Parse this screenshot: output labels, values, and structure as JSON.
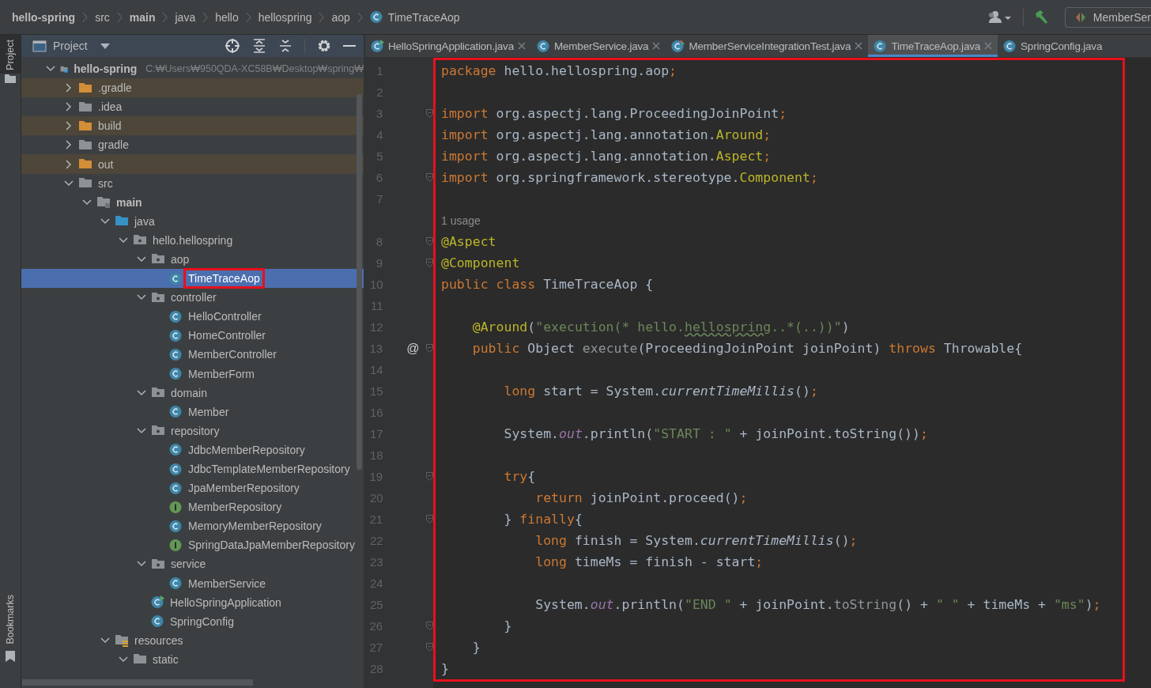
{
  "breadcrumb": [
    {
      "label": "hello-spring",
      "kind": "module"
    },
    {
      "label": "src",
      "kind": "folder"
    },
    {
      "label": "main",
      "kind": "source-set"
    },
    {
      "label": "java",
      "kind": "folder"
    },
    {
      "label": "hello",
      "kind": "folder"
    },
    {
      "label": "hellospring",
      "kind": "folder"
    },
    {
      "label": "aop",
      "kind": "folder"
    },
    {
      "label": "TimeTraceAop",
      "kind": "class"
    }
  ],
  "toolbar": {
    "run_config": "MemberSer"
  },
  "tool_stripe": {
    "top": [
      {
        "label": "Project",
        "selected": true
      }
    ],
    "bottom": [
      {
        "label": "Bookmarks",
        "selected": false
      }
    ]
  },
  "project_panel": {
    "title": "Project",
    "tree": [
      {
        "label": "hello-spring",
        "kind": "module",
        "path": "C:₩Users₩950QDA-XC58B₩Desktop₩spring₩",
        "expanded": true,
        "selected": false,
        "children": [
          {
            "label": ".gradle",
            "kind": "excluded",
            "expanded": false,
            "selected": false
          },
          {
            "label": ".idea",
            "kind": "folder",
            "expanded": false,
            "selected": false
          },
          {
            "label": "build",
            "kind": "excluded",
            "expanded": false,
            "selected": false
          },
          {
            "label": "gradle",
            "kind": "folder",
            "expanded": false,
            "selected": false
          },
          {
            "label": "out",
            "kind": "excluded",
            "expanded": false,
            "selected": false
          },
          {
            "label": "src",
            "kind": "folder",
            "expanded": true,
            "selected": false,
            "children": [
              {
                "label": "main",
                "kind": "source-set",
                "expanded": true,
                "selected": false,
                "children": [
                  {
                    "label": "java",
                    "kind": "source-root",
                    "expanded": true,
                    "selected": false,
                    "children": [
                      {
                        "label": "hello.hellospring",
                        "kind": "package",
                        "expanded": true,
                        "selected": false,
                        "children": [
                          {
                            "label": "aop",
                            "kind": "package",
                            "expanded": true,
                            "selected": false,
                            "children": [
                              {
                                "label": "TimeTraceAop",
                                "kind": "class",
                                "selected": true,
                                "annotated": true
                              }
                            ]
                          },
                          {
                            "label": "controller",
                            "kind": "package",
                            "expanded": true,
                            "selected": false,
                            "children": [
                              {
                                "label": "HelloController",
                                "kind": "class",
                                "selected": false
                              },
                              {
                                "label": "HomeController",
                                "kind": "class",
                                "selected": false
                              },
                              {
                                "label": "MemberController",
                                "kind": "class",
                                "selected": false
                              },
                              {
                                "label": "MemberForm",
                                "kind": "class",
                                "selected": false
                              }
                            ]
                          },
                          {
                            "label": "domain",
                            "kind": "package",
                            "expanded": true,
                            "selected": false,
                            "children": [
                              {
                                "label": "Member",
                                "kind": "class",
                                "selected": false
                              }
                            ]
                          },
                          {
                            "label": "repository",
                            "kind": "package",
                            "expanded": true,
                            "selected": false,
                            "children": [
                              {
                                "label": "JdbcMemberRepository",
                                "kind": "class",
                                "selected": false
                              },
                              {
                                "label": "JdbcTemplateMemberRepository",
                                "kind": "class",
                                "selected": false
                              },
                              {
                                "label": "JpaMemberRepository",
                                "kind": "class",
                                "selected": false
                              },
                              {
                                "label": "MemberRepository",
                                "kind": "interface",
                                "selected": false
                              },
                              {
                                "label": "MemoryMemberRepository",
                                "kind": "class",
                                "selected": false
                              },
                              {
                                "label": "SpringDataJpaMemberRepository",
                                "kind": "interface",
                                "selected": false
                              }
                            ]
                          },
                          {
                            "label": "service",
                            "kind": "package",
                            "expanded": true,
                            "selected": false,
                            "children": [
                              {
                                "label": "MemberService",
                                "kind": "class",
                                "selected": false
                              }
                            ]
                          },
                          {
                            "label": "HelloSpringApplication",
                            "kind": "runnable-class",
                            "selected": false
                          },
                          {
                            "label": "SpringConfig",
                            "kind": "class",
                            "selected": false
                          }
                        ]
                      }
                    ]
                  },
                  {
                    "label": "resources",
                    "kind": "resources",
                    "expanded": true,
                    "selected": false,
                    "children": [
                      {
                        "label": "static",
                        "kind": "folder",
                        "expanded": true,
                        "selected": false
                      }
                    ]
                  }
                ]
              }
            ]
          }
        ]
      }
    ]
  },
  "tabs": [
    {
      "label": "HelloSpringApplication.java",
      "kind": "runnable-class",
      "selected": false,
      "closable": true
    },
    {
      "label": "MemberService.java",
      "kind": "class",
      "selected": false,
      "closable": true
    },
    {
      "label": "MemberServiceIntegrationTest.java",
      "kind": "test-class",
      "selected": false,
      "closable": true
    },
    {
      "label": "TimeTraceAop.java",
      "kind": "class",
      "selected": true,
      "closable": true
    },
    {
      "label": "SpringConfig.java",
      "kind": "class",
      "selected": false,
      "closable": false
    }
  ],
  "editor": {
    "annotated": true,
    "lines": [
      {
        "kind": "code",
        "number": "1",
        "fold": false,
        "tokens": [
          {
            "kind": "keyword",
            "text": "package"
          },
          {
            "kind": "plain",
            "text": " hello.hellospring.aop"
          },
          {
            "kind": "keyword",
            "text": ";"
          }
        ]
      },
      {
        "kind": "code",
        "number": "2",
        "fold": false
      },
      {
        "kind": "code",
        "number": "3",
        "fold": true,
        "tokens": [
          {
            "kind": "keyword",
            "text": "import"
          },
          {
            "kind": "plain",
            "text": " org.aspectj.lang.ProceedingJoinPoint"
          },
          {
            "kind": "keyword",
            "text": ";"
          }
        ]
      },
      {
        "kind": "code",
        "number": "4",
        "fold": false,
        "tokens": [
          {
            "kind": "keyword",
            "text": "import"
          },
          {
            "kind": "plain",
            "text": " org.aspectj.lang.annotation."
          },
          {
            "kind": "annotation",
            "text": "Around"
          },
          {
            "kind": "keyword",
            "text": ";"
          }
        ]
      },
      {
        "kind": "code",
        "number": "5",
        "fold": false,
        "tokens": [
          {
            "kind": "keyword",
            "text": "import"
          },
          {
            "kind": "plain",
            "text": " org.aspectj.lang.annotation."
          },
          {
            "kind": "annotation",
            "text": "Aspect"
          },
          {
            "kind": "keyword",
            "text": ";"
          }
        ]
      },
      {
        "kind": "code",
        "number": "6",
        "fold": true,
        "tokens": [
          {
            "kind": "keyword",
            "text": "import"
          },
          {
            "kind": "plain",
            "text": " org.springframework.stereotype."
          },
          {
            "kind": "annotation",
            "text": "Component"
          },
          {
            "kind": "keyword",
            "text": ";"
          }
        ]
      },
      {
        "kind": "code",
        "number": "7",
        "fold": false
      },
      {
        "kind": "hint",
        "text": "1 usage"
      },
      {
        "kind": "code",
        "number": "8",
        "fold": true,
        "tokens": [
          {
            "kind": "annotation",
            "text": "@Aspect"
          }
        ]
      },
      {
        "kind": "code",
        "number": "9",
        "fold": true,
        "tokens": [
          {
            "kind": "annotation",
            "text": "@Component"
          }
        ]
      },
      {
        "kind": "code",
        "number": "10",
        "fold": false,
        "tokens": [
          {
            "kind": "keyword",
            "text": "public class "
          },
          {
            "kind": "plain",
            "text": "TimeTraceAop {"
          }
        ]
      },
      {
        "kind": "code",
        "number": "11",
        "fold": false
      },
      {
        "kind": "code",
        "number": "12",
        "fold": false,
        "tokens": [
          {
            "kind": "annotation",
            "text": "    @Around"
          },
          {
            "kind": "plain",
            "text": "("
          },
          {
            "kind": "string",
            "text": "\"execution(* hello."
          },
          {
            "kind": "string-warning",
            "text": "hellospring"
          },
          {
            "kind": "string",
            "text": "..*(..))\""
          },
          {
            "kind": "plain",
            "text": ")"
          }
        ]
      },
      {
        "kind": "code",
        "number": "13",
        "fold": true,
        "gutter_mark": "@",
        "tokens": [
          {
            "kind": "keyword",
            "text": "    public "
          },
          {
            "kind": "plain",
            "text": "Object "
          },
          {
            "kind": "unused",
            "text": "execute"
          },
          {
            "kind": "plain",
            "text": "(ProceedingJoinPoint joinPoint) "
          },
          {
            "kind": "keyword",
            "text": "throws "
          },
          {
            "kind": "plain",
            "text": "Throwable{"
          }
        ]
      },
      {
        "kind": "code",
        "number": "14",
        "fold": false
      },
      {
        "kind": "code",
        "number": "15",
        "fold": false,
        "tokens": [
          {
            "kind": "keyword",
            "text": "        long "
          },
          {
            "kind": "plain",
            "text": "start = System."
          },
          {
            "kind": "static-method",
            "text": "currentTimeMillis"
          },
          {
            "kind": "plain",
            "text": "()"
          },
          {
            "kind": "keyword",
            "text": ";"
          }
        ]
      },
      {
        "kind": "code",
        "number": "16",
        "fold": false
      },
      {
        "kind": "code",
        "number": "17",
        "fold": false,
        "tokens": [
          {
            "kind": "plain",
            "text": "        System."
          },
          {
            "kind": "static-field",
            "text": "out"
          },
          {
            "kind": "plain",
            "text": ".println("
          },
          {
            "kind": "string",
            "text": "\"START : \""
          },
          {
            "kind": "plain",
            "text": " + joinPoint.toString())"
          },
          {
            "kind": "keyword",
            "text": ";"
          }
        ]
      },
      {
        "kind": "code",
        "number": "18",
        "fold": false
      },
      {
        "kind": "code",
        "number": "19",
        "fold": true,
        "tokens": [
          {
            "kind": "keyword",
            "text": "        try"
          },
          {
            "kind": "plain",
            "text": "{"
          }
        ]
      },
      {
        "kind": "code",
        "number": "20",
        "fold": false,
        "tokens": [
          {
            "kind": "keyword",
            "text": "            return "
          },
          {
            "kind": "plain",
            "text": "joinPoint.proceed()"
          },
          {
            "kind": "keyword",
            "text": ";"
          }
        ]
      },
      {
        "kind": "code",
        "number": "21",
        "fold": true,
        "tokens": [
          {
            "kind": "plain",
            "text": "        } "
          },
          {
            "kind": "keyword",
            "text": "finally"
          },
          {
            "kind": "plain",
            "text": "{"
          }
        ]
      },
      {
        "kind": "code",
        "number": "22",
        "fold": false,
        "tokens": [
          {
            "kind": "keyword",
            "text": "            long "
          },
          {
            "kind": "plain",
            "text": "finish = System."
          },
          {
            "kind": "static-method",
            "text": "currentTimeMillis"
          },
          {
            "kind": "plain",
            "text": "()"
          },
          {
            "kind": "keyword",
            "text": ";"
          }
        ]
      },
      {
        "kind": "code",
        "number": "23",
        "fold": false,
        "tokens": [
          {
            "kind": "keyword",
            "text": "            long "
          },
          {
            "kind": "plain",
            "text": "timeMs = finish - start"
          },
          {
            "kind": "keyword",
            "text": ";"
          }
        ]
      },
      {
        "kind": "code",
        "number": "24",
        "fold": false
      },
      {
        "kind": "code",
        "number": "25",
        "fold": false,
        "tokens": [
          {
            "kind": "plain",
            "text": "            System."
          },
          {
            "kind": "static-field",
            "text": "out"
          },
          {
            "kind": "plain",
            "text": ".println("
          },
          {
            "kind": "string",
            "text": "\"END \""
          },
          {
            "kind": "plain",
            "text": " + joinPoint."
          },
          {
            "kind": "unused",
            "text": "toString"
          },
          {
            "kind": "plain",
            "text": "() + "
          },
          {
            "kind": "string",
            "text": "\" \""
          },
          {
            "kind": "plain",
            "text": " + timeMs + "
          },
          {
            "kind": "string",
            "text": "\"ms\""
          },
          {
            "kind": "plain",
            "text": ")"
          },
          {
            "kind": "keyword",
            "text": ";"
          }
        ]
      },
      {
        "kind": "code",
        "number": "26",
        "fold": true,
        "tokens": [
          {
            "kind": "plain",
            "text": "        }"
          }
        ]
      },
      {
        "kind": "code",
        "number": "27",
        "fold": true,
        "tokens": [
          {
            "kind": "plain",
            "text": "    }"
          }
        ]
      },
      {
        "kind": "code",
        "number": "28",
        "fold": false,
        "tokens": [
          {
            "kind": "plain",
            "text": "}"
          }
        ]
      }
    ]
  }
}
